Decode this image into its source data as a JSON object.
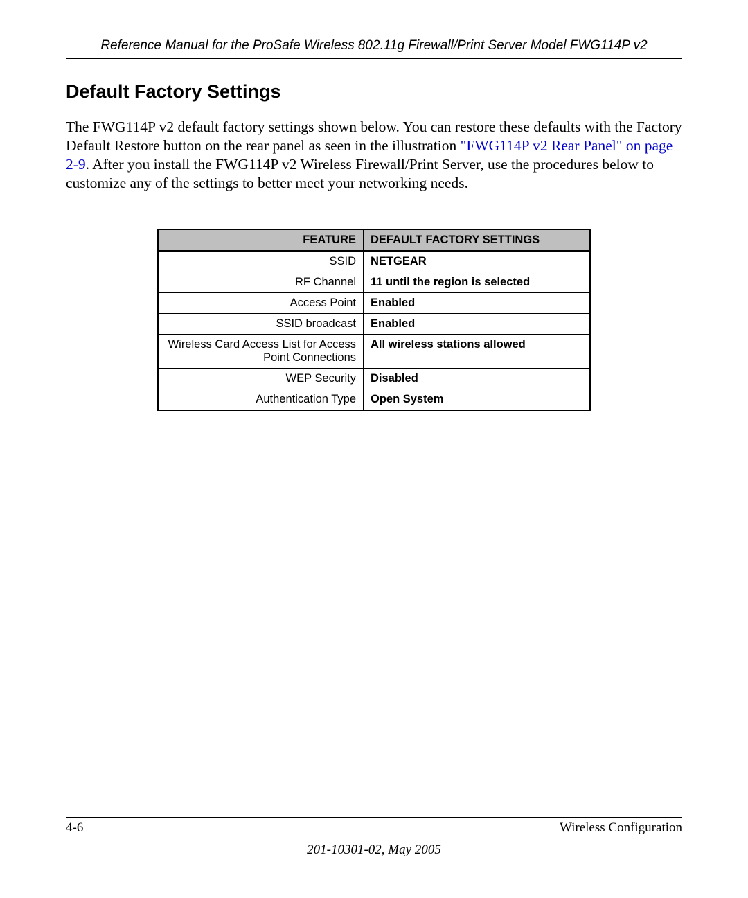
{
  "header": "Reference Manual for the ProSafe Wireless 802.11g  Firewall/Print Server Model FWG114P v2",
  "section_title": "Default Factory Settings",
  "para": {
    "p1": "The FWG114P v2 default factory settings shown below. You can restore these defaults with the Factory Default Restore button on the rear panel as seen in the illustration ",
    "link": "\"FWG114P v2 Rear Panel\" on page 2-9",
    "p2": ". After you install the FWG114P v2 Wireless Firewall/Print Server, use the procedures below to customize any of the settings to better meet your networking needs."
  },
  "table": {
    "headers": {
      "feature": "Feature",
      "default": "Default Factory Settings"
    },
    "rows": [
      {
        "feature": "SSID",
        "value": "NETGEAR"
      },
      {
        "feature": "RF Channel",
        "value": "11 until the region is selected"
      },
      {
        "feature": "Access Point",
        "value": "Enabled"
      },
      {
        "feature": "SSID broadcast",
        "value": "Enabled"
      },
      {
        "feature": "Wireless Card Access List for Access Point Connections",
        "value": "All wireless stations allowed"
      },
      {
        "feature": "WEP Security",
        "value": "Disabled"
      },
      {
        "feature": "Authentication Type",
        "value": "Open System"
      }
    ]
  },
  "footer": {
    "page": "4-6",
    "chapter": "Wireless Configuration",
    "docid": "201-10301-02, May 2005"
  }
}
